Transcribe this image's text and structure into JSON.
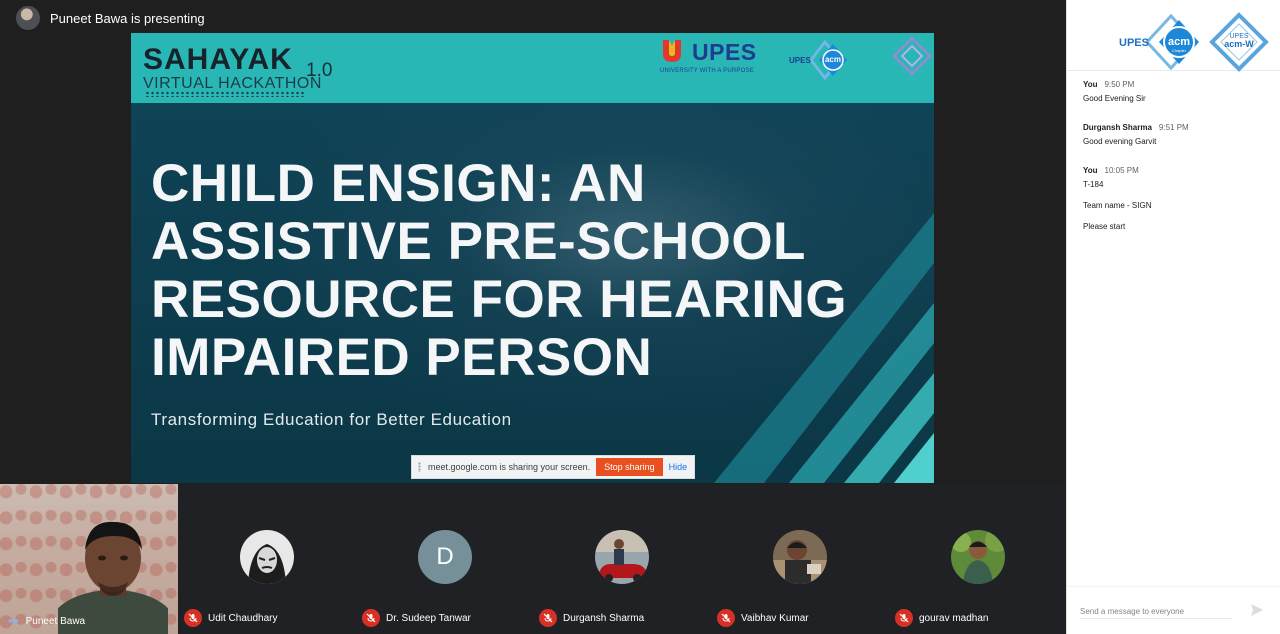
{
  "presenter": {
    "text": "Puneet Bawa is presenting"
  },
  "slide": {
    "event_logo": {
      "word": "SAHAYAK",
      "version": "1.0",
      "subtitle": "VIRTUAL HACKATHON"
    },
    "upes_logo": {
      "name": "UPES",
      "tagline": "UNIVERSITY WITH A PURPOSE"
    },
    "acm_logo": {
      "org": "UPES",
      "name": "acm",
      "sub": "Chapter"
    },
    "title_lines": [
      "CHILD ENSIGN: AN",
      "ASSISTIVE PRE-SCHOOL",
      "RESOURCE FOR HEARING",
      "IMPAIRED PERSON"
    ],
    "subtitle": "Transforming Education for Better Education"
  },
  "share_banner": {
    "text": "meet.google.com is sharing your screen.",
    "stop_label": "Stop sharing",
    "hide_label": "Hide"
  },
  "participants": [
    {
      "name": "Puneet Bawa",
      "self": true
    },
    {
      "name": "Udit Chaudhary",
      "muted": true,
      "avatar": "photo"
    },
    {
      "name": "Dr. Sudeep Tanwar",
      "muted": true,
      "avatar": "letter",
      "letter": "D"
    },
    {
      "name": "Durgansh Sharma",
      "muted": true,
      "avatar": "photo"
    },
    {
      "name": "Vaibhav Kumar",
      "muted": true,
      "avatar": "photo"
    },
    {
      "name": "gourav madhan",
      "muted": true,
      "avatar": "photo"
    }
  ],
  "chat": {
    "header_logos": {
      "upes": "UPES",
      "acm": "acm",
      "acm_sub": "Chapter",
      "acmw_upes": "UPES",
      "acmw": "acm-W"
    },
    "messages": [
      {
        "sender": "You",
        "time": "9:50 PM",
        "lines": [
          "Good Evening Sir"
        ]
      },
      {
        "sender": "Durgansh Sharma",
        "time": "9:51 PM",
        "lines": [
          "Good evening Garvit"
        ]
      },
      {
        "sender": "You",
        "time": "10:05 PM",
        "lines": [
          "T-184",
          "Team name - SIGN",
          "Please start"
        ]
      }
    ],
    "input_placeholder": "Send a message to everyone"
  },
  "colors": {
    "slide_header": "#28b7b5",
    "slide_body": "#0d3c4c",
    "stop_button": "#e8501f",
    "mute": "#d93025",
    "acm_blue": "#1e88d8"
  }
}
